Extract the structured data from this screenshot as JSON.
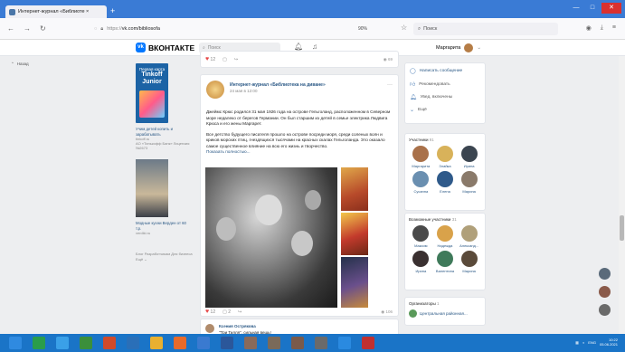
{
  "browser": {
    "tab_title": "Интернет-журнал «Библиоте ×",
    "tab_close": "×",
    "new_tab": "+",
    "url_scheme": "https://",
    "url_host": "vk.com/bibliosofa",
    "zoom": "90%",
    "search_placeholder": "Поиск"
  },
  "vk": {
    "logo_text": "ВКОНТАКТЕ",
    "search_placeholder": "Поиск",
    "user_name": "Маргарита"
  },
  "left": {
    "back_link": "Назад",
    "ad1_small": "Первая карта",
    "ad1_big": "Tinkoff Junior",
    "ad1_text": "Учим детей копить и зарабатывать",
    "ad1_sub1": "tinkoff.ru",
    "ad1_sub2": "АО «Тинькофф Банк» Лицензия №2673",
    "ad2_text": "Модные кухни Верден от 60 т.р.",
    "ad2_sub": "verdiki.ru",
    "footer": "Блог  Разработчикам  Для бизнеса  Ещё ⌄"
  },
  "feed": {
    "top_card": {
      "likes": "12",
      "views": "69"
    },
    "post": {
      "author": "Интернет-журнал «Библиотека на диване»",
      "date": "24 мая в 12:00",
      "para1": "Джеймс Крюс родился 31 мая 1926 года на острове Гельголанд, расположенном в Северном море недалеко от берегов Германии. Он был старшим из детей в семье электрика Людвига Крюса и его жены Маргарет.",
      "para2": "Все детство будущего писателя прошло на острове посреди моря, среди соленых волн и криков морских птиц, гнездящихся тысячами на красных скалах Гельголанда. Это оказало самое существенное влияние на всю его жизнь и творчество.",
      "show_more": "Показать полностью...",
      "likes": "12",
      "comments": "2",
      "views": "106"
    },
    "comment": {
      "author": "Ксения Острякова",
      "text": "\"Три Тилля\", сильная вещь!"
    }
  },
  "right": {
    "actions": [
      "Написать сообщение",
      "Рекомендовать",
      "Увед. включены",
      "Ещё"
    ],
    "members_title": "Участники",
    "members_count": "91",
    "members": [
      "Маргарита",
      "Злайка",
      "Ирина",
      "Сусанна",
      "Елена",
      "Марина"
    ],
    "possible_title": "Возможные участники",
    "possible_count": "31",
    "possible": [
      "Максим",
      "Надежда",
      "Александ...",
      "Ирина",
      "Валентина",
      "Марина"
    ],
    "organizers_title": "Организаторы",
    "organizers_count": "1",
    "organizer": "Центральная районная..."
  },
  "taskbar": {
    "lang": "ENG",
    "time": "10:22",
    "date": "05.06.2021"
  },
  "colors": {
    "vk_blue": "#0077ff",
    "link": "#2a5885",
    "taskbar": "#1a74c7",
    "tabbar": "#3a7bd5"
  }
}
